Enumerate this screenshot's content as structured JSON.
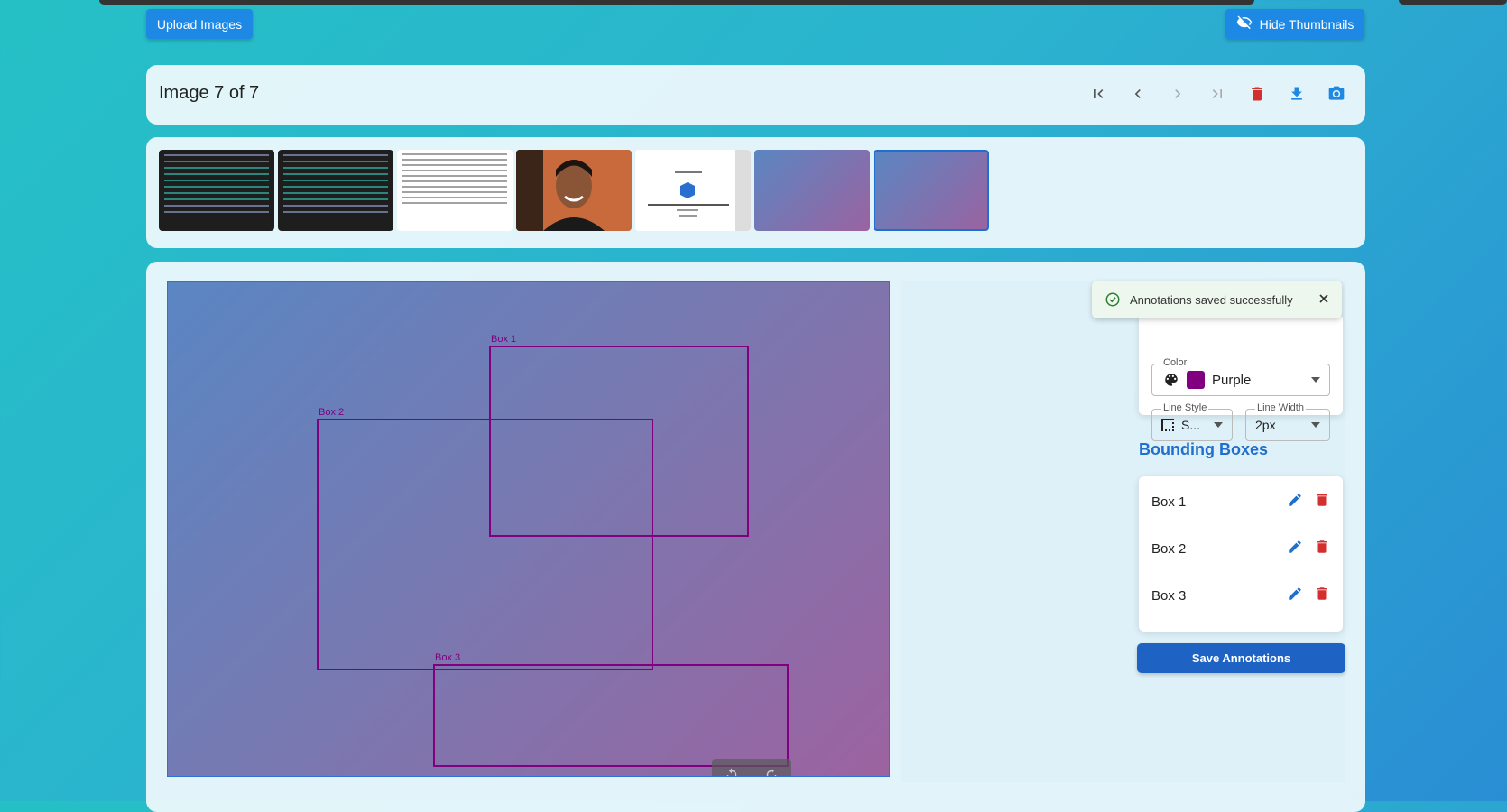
{
  "toolbar": {
    "upload_label": "Upload Images",
    "hide_thumbnails_label": "Hide Thumbnails"
  },
  "nav": {
    "title": "Image 7 of 7",
    "icons": [
      "first-page-icon",
      "prev-icon",
      "next-icon",
      "last-page-icon",
      "delete-icon",
      "download-icon",
      "camera-icon"
    ]
  },
  "thumbnails": [
    {
      "kind": "terminal"
    },
    {
      "kind": "terminal"
    },
    {
      "kind": "document"
    },
    {
      "kind": "photo"
    },
    {
      "kind": "document"
    },
    {
      "kind": "gradient"
    },
    {
      "kind": "gradient",
      "selected": true
    }
  ],
  "boxes": [
    {
      "label": "Box 1"
    },
    {
      "label": "Box 2"
    },
    {
      "label": "Box 3"
    }
  ],
  "toast": {
    "message": "Annotations saved successfully"
  },
  "style": {
    "color_label": "Color",
    "color_value": "Purple",
    "color_hex": "#800080",
    "line_style_label": "Line Style",
    "line_style_value": "S...",
    "line_width_label": "Line Width",
    "line_width_value": "2px"
  },
  "bounding_boxes": {
    "title": "Bounding Boxes",
    "items": [
      {
        "label": "Box 1"
      },
      {
        "label": "Box 2"
      },
      {
        "label": "Box 3"
      }
    ]
  },
  "save_label": "Save Annotations",
  "colors": {
    "accent": "#1e88e5",
    "danger": "#d32f2f",
    "box": "#800080"
  }
}
